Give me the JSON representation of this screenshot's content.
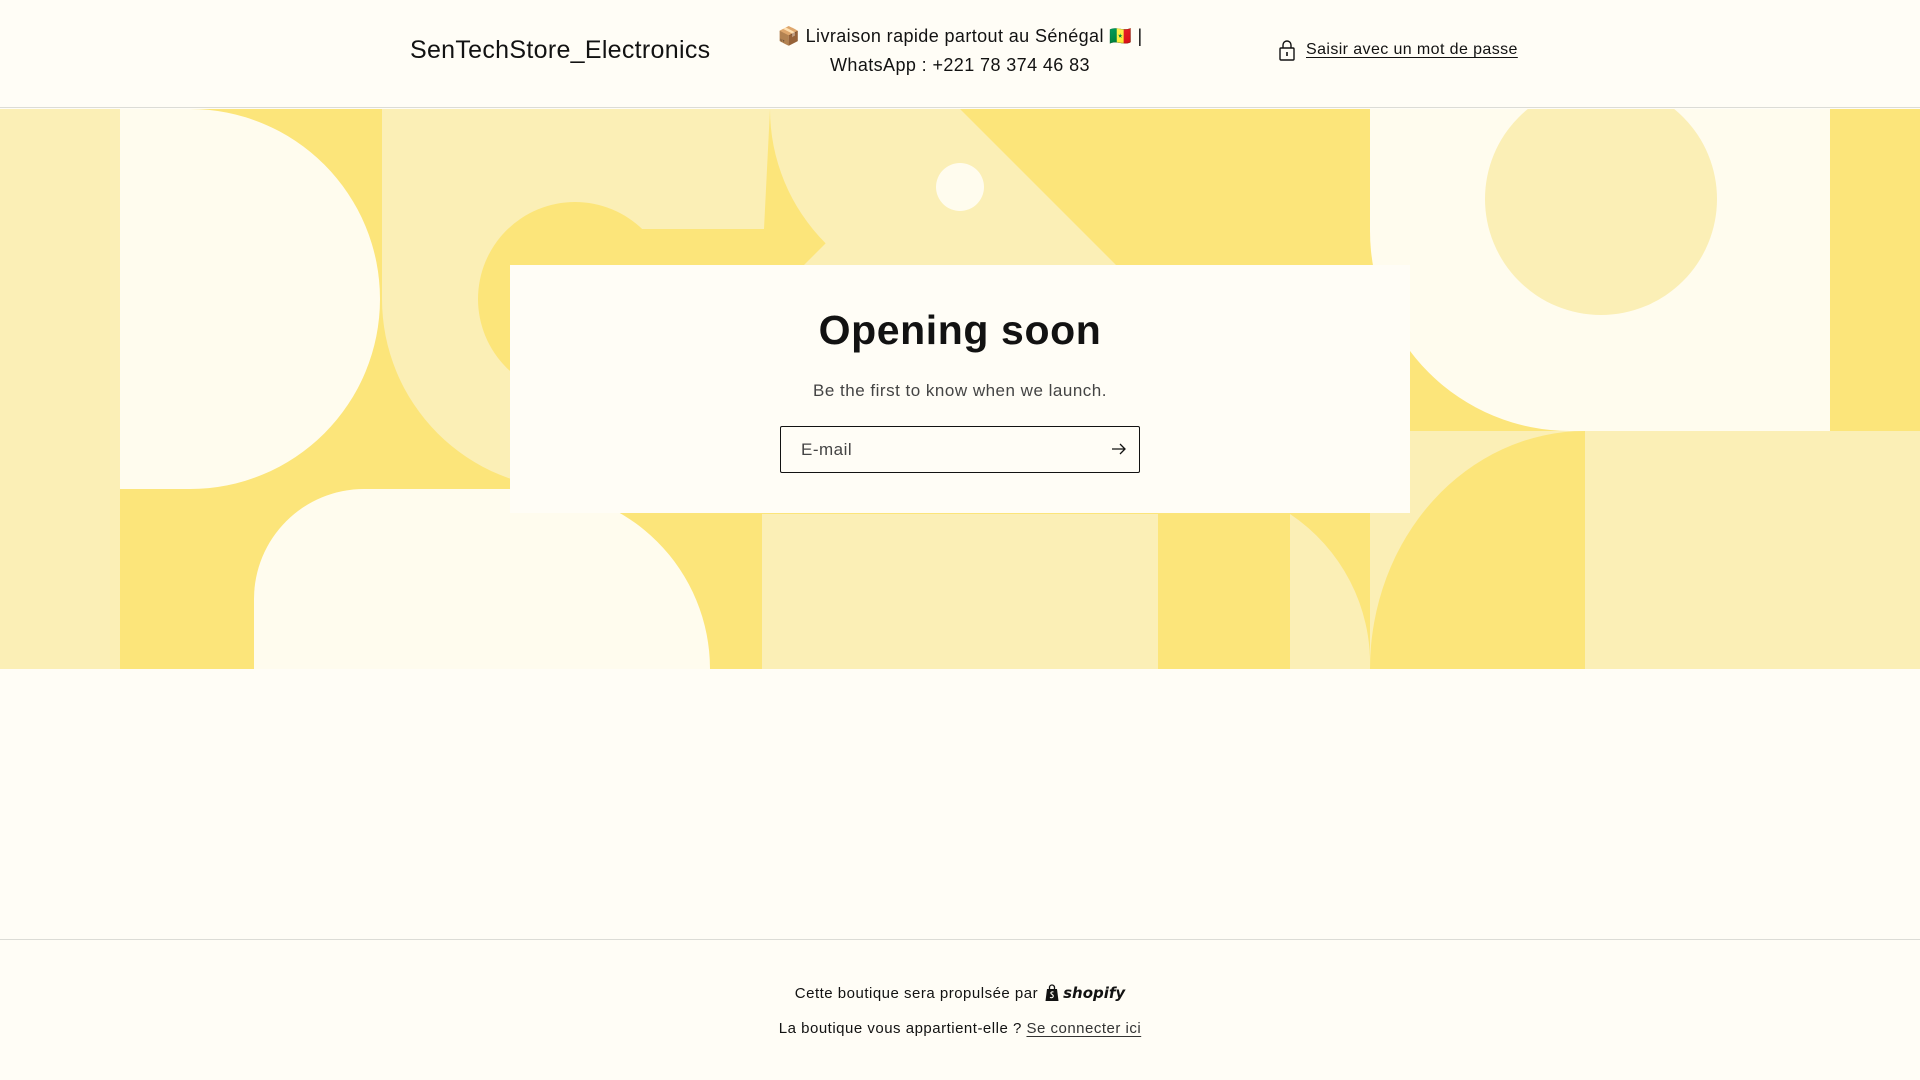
{
  "header": {
    "store_name": "SenTechStore_Electronics",
    "announcement": "📦 Livraison rapide partout au Sénégal 🇸🇳 | WhatsApp : +221 78 374 46 83",
    "password_link": "Saisir avec un mot de passe",
    "password_icon": "lock-icon"
  },
  "signup": {
    "title": "Opening soon",
    "subtitle": "Be the first to know when we launch.",
    "email_placeholder": "E-mail",
    "email_value": "",
    "submit_icon": "arrow-right-icon"
  },
  "footer": {
    "powered_by": "Cette boutique sera propulsée par",
    "shopify_wordmark": "shopify",
    "owner_question": "La boutique vous appartient-elle ?",
    "login_link": "Se connecter ici"
  },
  "colors": {
    "background": "#fffdf6",
    "yellow_strong": "#fce57a",
    "yellow_light": "#fbefb6",
    "cream": "#fffcee",
    "text": "#121212"
  }
}
